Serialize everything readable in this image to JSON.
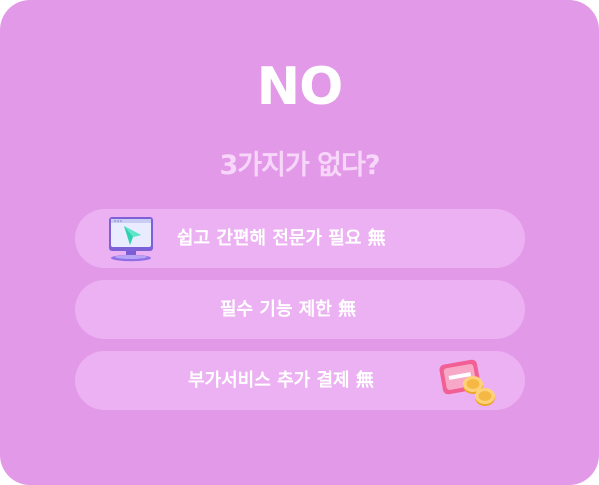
{
  "heading": {
    "title": "NO",
    "subtitle": "3가지가 없다?"
  },
  "items": [
    {
      "label": "쉽고 간편해 전문가 필요 無",
      "icon": "monitor-cursor-icon"
    },
    {
      "label": "필수 기능 제한 無",
      "icon": ""
    },
    {
      "label": "부가서비스 추가 결제 無",
      "icon": "card-coins-icon"
    }
  ],
  "colors": {
    "background": "#e299e8",
    "pill": "#ecb1f2",
    "text": "#ffffff",
    "subtitle": "#f7d6fa"
  }
}
